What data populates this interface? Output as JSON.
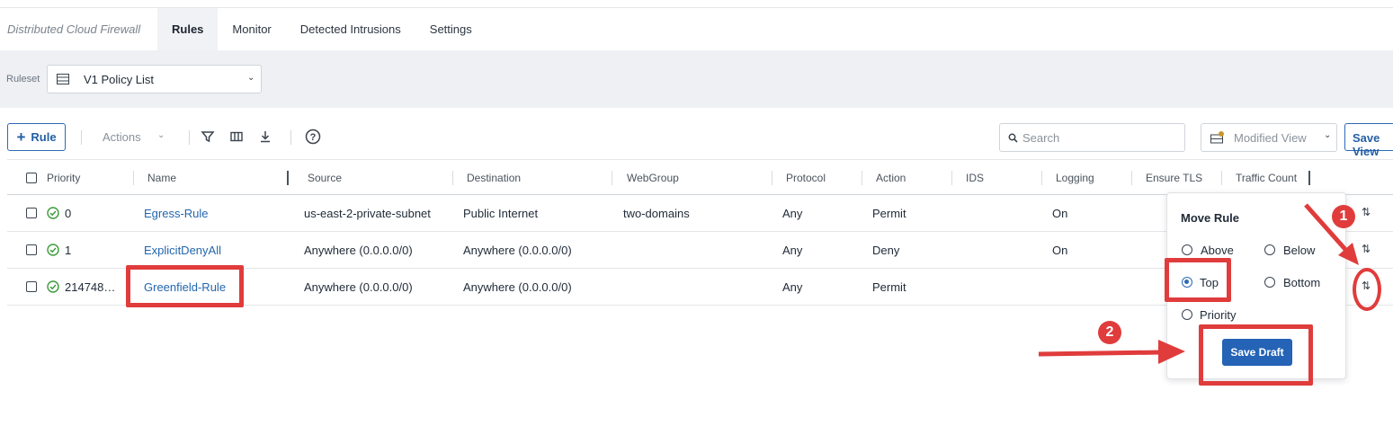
{
  "app": {
    "name": "Distributed Cloud Firewall"
  },
  "tabs": [
    {
      "label": "Rules",
      "active": true
    },
    {
      "label": "Monitor",
      "active": false
    },
    {
      "label": "Detected Intrusions",
      "active": false
    },
    {
      "label": "Settings",
      "active": false
    }
  ],
  "ruleset": {
    "label": "Ruleset",
    "value": "V1 Policy List"
  },
  "toolbar": {
    "add_rule_label": "Rule",
    "actions_label": "Actions",
    "search_placeholder": "Search",
    "view_value": "Modified View",
    "save_view_label": "Save View"
  },
  "table": {
    "columns": [
      "Priority",
      "Name",
      "Source",
      "Destination",
      "WebGroup",
      "Protocol",
      "Action",
      "IDS",
      "Logging",
      "Ensure TLS",
      "Traffic Count"
    ],
    "rows": [
      {
        "priority": "0",
        "name": "Egress-Rule",
        "source": "us-east-2-private-subnet",
        "destination": "Public Internet",
        "webgroup": "two-domains",
        "protocol": "Any",
        "action": "Permit",
        "logging": "On"
      },
      {
        "priority": "1",
        "name": "ExplicitDenyAll",
        "source": "Anywhere (0.0.0.0/0)",
        "destination": "Anywhere (0.0.0.0/0)",
        "webgroup": "",
        "protocol": "Any",
        "action": "Deny",
        "logging": "On"
      },
      {
        "priority": "214748…",
        "name": "Greenfield-Rule",
        "source": "Anywhere (0.0.0.0/0)",
        "destination": "Anywhere (0.0.0.0/0)",
        "webgroup": "",
        "protocol": "Any",
        "action": "Permit",
        "logging": ""
      }
    ]
  },
  "move_rule": {
    "title": "Move Rule",
    "options": [
      "Above",
      "Below",
      "Top",
      "Bottom",
      "Priority"
    ],
    "selected": "Top",
    "save_label": "Save Draft"
  },
  "annotations": {
    "step1": "1",
    "step2": "2"
  },
  "colors": {
    "accent": "#2463b6",
    "link": "#2366ad",
    "highlight": "#e03c3c",
    "success": "#3a9a3a"
  }
}
